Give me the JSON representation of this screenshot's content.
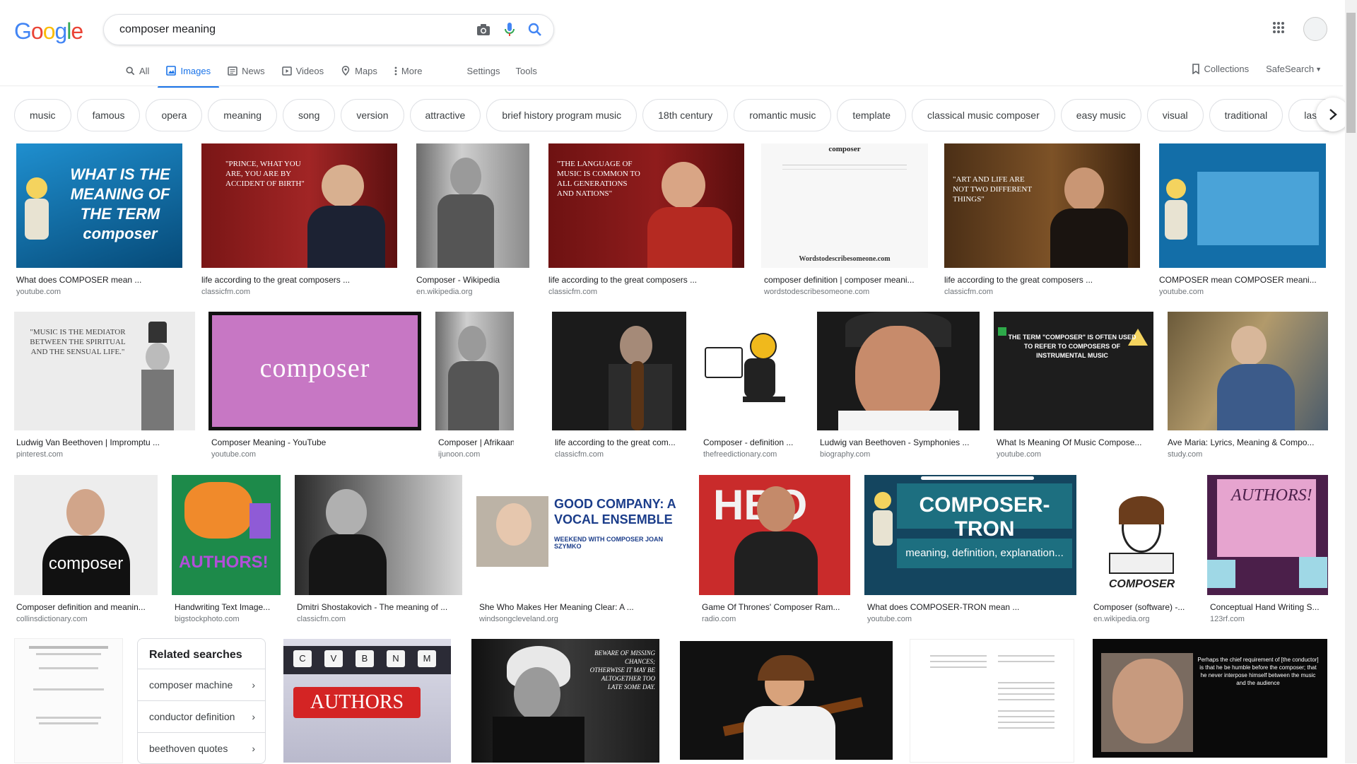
{
  "search": {
    "query": "composer meaning"
  },
  "logo": {
    "text": "Google"
  },
  "tabs": [
    {
      "label": "All"
    },
    {
      "label": "Images"
    },
    {
      "label": "News"
    },
    {
      "label": "Videos"
    },
    {
      "label": "Maps"
    },
    {
      "label": "More"
    }
  ],
  "tools": {
    "settings": "Settings",
    "tools": "Tools",
    "collections": "Collections",
    "safesearch": "SafeSearch"
  },
  "chips": [
    "music",
    "famous",
    "opera",
    "meaning",
    "song",
    "version",
    "attractive",
    "brief history program music",
    "18th century",
    "romantic music",
    "template",
    "classical music composer",
    "easy music",
    "visual",
    "traditional",
    "last wor"
  ],
  "results": {
    "r1": [
      {
        "title": "What does COMPOSER mean ...",
        "source": "youtube.com",
        "overlay": "WHAT IS THE MEANING OF THE TERM composer"
      },
      {
        "title": "life according to the great composers ...",
        "source": "classicfm.com",
        "overlay": "\"PRINCE, WHAT YOU ARE, YOU ARE BY ACCIDENT OF BIRTH\""
      },
      {
        "title": "Composer - Wikipedia",
        "source": "en.wikipedia.org"
      },
      {
        "title": "life according to the great composers ...",
        "source": "classicfm.com",
        "overlay": "\"THE LANGUAGE OF MUSIC IS COMMON TO ALL GENERATIONS AND NATIONS\""
      },
      {
        "title": "composer definition | composer meani...",
        "source": "wordstodescribesomeone.com",
        "overlay": "composer",
        "overlay2": "Wordstodescribesomeone.com"
      },
      {
        "title": "life according to the great composers ...",
        "source": "classicfm.com",
        "overlay": "\"ART AND LIFE ARE NOT TWO DIFFERENT THINGS\""
      },
      {
        "title": "COMPOSER mean COMPOSER meani...",
        "source": "youtube.com"
      }
    ],
    "r2": [
      {
        "title": "Ludwig Van Beethoven | Impromptu ...",
        "source": "pinterest.com",
        "overlay": "\"MUSIC IS THE MEDIATOR BETWEEN THE SPIRITUAL AND THE SENSUAL LIFE.\""
      },
      {
        "title": "Composer Meaning - YouTube",
        "source": "youtube.com",
        "overlay": "composer"
      },
      {
        "title": "Composer | Afrikaans ...",
        "source": "ijunoon.com"
      },
      {
        "title": "life according to the great com...",
        "source": "classicfm.com"
      },
      {
        "title": "Composer - definition ...",
        "source": "thefreedictionary.com"
      },
      {
        "title": "Ludwig van Beethoven - Symphonies ...",
        "source": "biography.com"
      },
      {
        "title": "What Is Meaning Of Music Compose...",
        "source": "youtube.com",
        "overlay": "THE TERM \"COMPOSER\" IS OFTEN USED TO REFER TO COMPOSERS OF INSTRUMENTAL MUSIC"
      },
      {
        "title": "Ave Maria: Lyrics, Meaning & Compo...",
        "source": "study.com"
      }
    ],
    "r3": [
      {
        "title": "Composer definition and meanin...",
        "source": "collinsdictionary.com",
        "overlay": "composer"
      },
      {
        "title": "Handwriting Text Image...",
        "source": "bigstockphoto.com",
        "overlay": "AUTHORS!"
      },
      {
        "title": "Dmitri Shostakovich - The meaning of ...",
        "source": "classicfm.com"
      },
      {
        "title": "She Who Makes Her Meaning Clear: A ...",
        "source": "windsongcleveland.org",
        "overlay": "GOOD COMPANY: A VOCAL ENSEMBLE",
        "overlay2": "WEEKEND WITH COMPOSER JOAN SZYMKO"
      },
      {
        "title": "Game Of Thrones' Composer Ram...",
        "source": "radio.com",
        "overlay": "HBO"
      },
      {
        "title": "What does COMPOSER-TRON mean ...",
        "source": "youtube.com",
        "overlay": "COMPOSER-TRON",
        "overlay2": "meaning, definition, explanation..."
      },
      {
        "title": "Composer (software) -...",
        "source": "en.wikipedia.org",
        "overlay": "COMPOSER"
      },
      {
        "title": "Conceptual Hand Writing S...",
        "source": "123rf.com",
        "overlay": "AUTHORS!"
      }
    ],
    "r4_overlays": {
      "authors_key": "AUTHORS",
      "keys": [
        "C",
        "V",
        "B",
        "N",
        "M"
      ],
      "liszt": "BEWARE OF MISSING CHANCES; OTHERWISE IT MAY BE ALTOGETHER TOO LATE SOME DAY.",
      "bernstein": "Perhaps the chief requirement of [the conductor] is that he be humble before the composer; that he never interpose himself between the music and the audience"
    }
  },
  "related": {
    "heading": "Related searches",
    "items": [
      "composer machine",
      "conductor definition",
      "beethoven quotes"
    ]
  }
}
